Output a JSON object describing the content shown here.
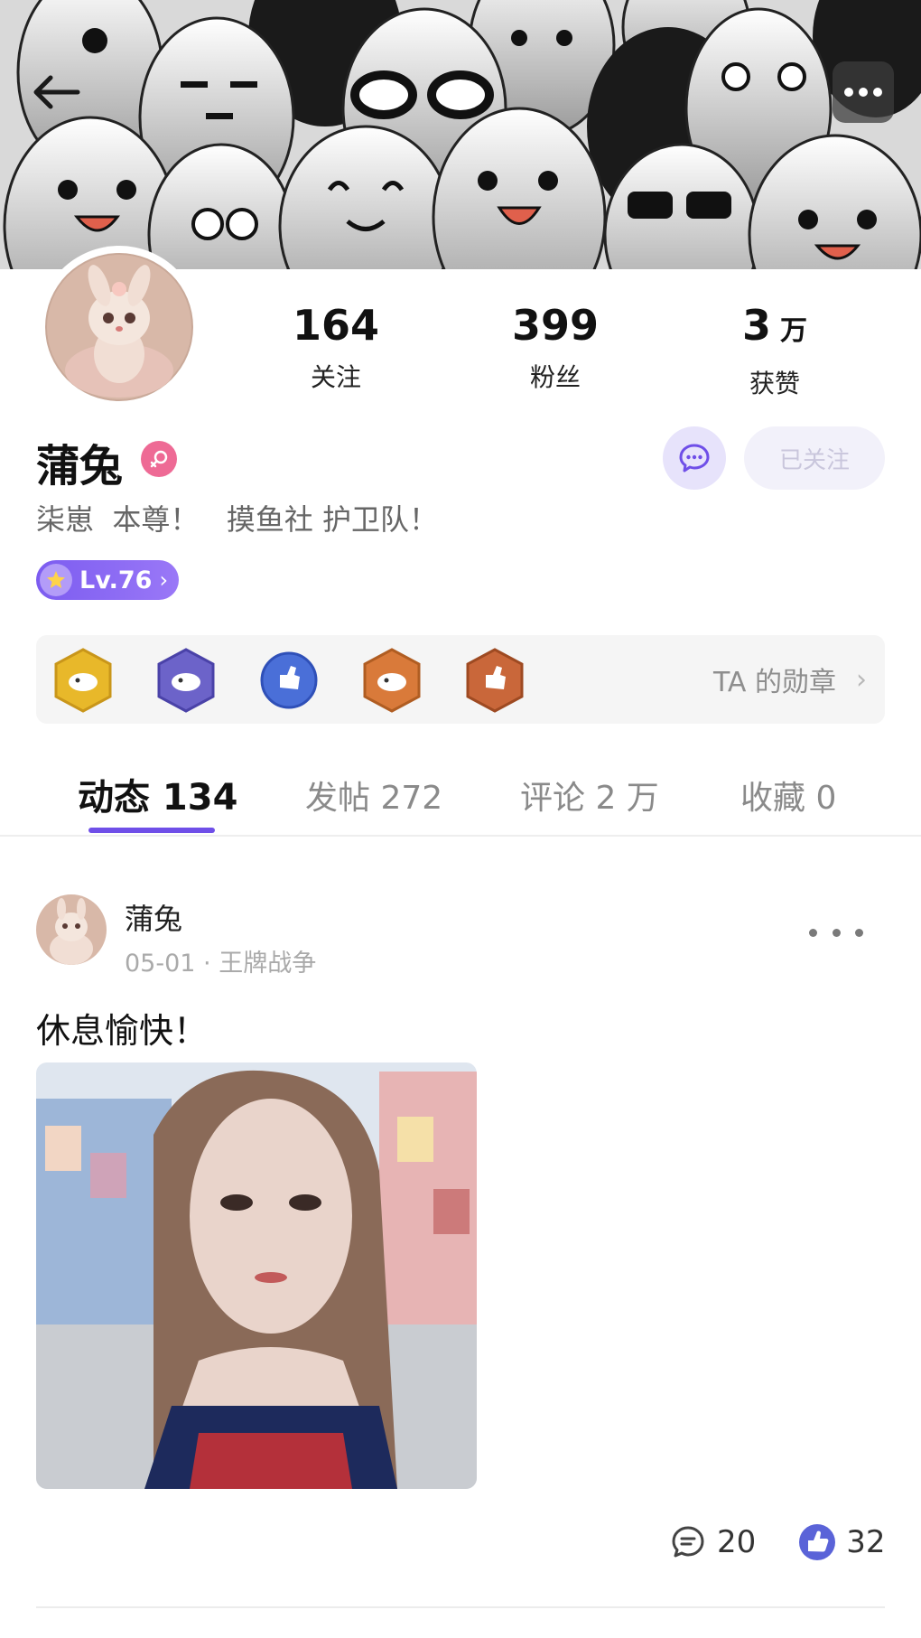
{
  "profile": {
    "name": "蒲兔",
    "bio": "柒崽  本尊！   摸鱼社 护卫队！",
    "level": "Lv.76",
    "stats": [
      {
        "value": "164",
        "unit": "",
        "label": "关注"
      },
      {
        "value": "399",
        "unit": "",
        "label": "粉丝"
      },
      {
        "value": "3",
        "unit": "万",
        "label": "获赞"
      }
    ],
    "follow_label": "已关注"
  },
  "medals": {
    "link_label": "TA 的勋章",
    "colors": [
      "#e8b82a",
      "#6c63c9",
      "#4a6fd8",
      "#d97a3a",
      "#c9673a"
    ]
  },
  "tabs": [
    {
      "label": "动态 134"
    },
    {
      "label": "发帖 272"
    },
    {
      "label": "评论 2 万"
    },
    {
      "label": "收藏 0"
    }
  ],
  "post": {
    "author": "蒲兔",
    "meta": "05-01 · 王牌战争",
    "text": "休息愉快！",
    "comments": "20",
    "likes": "32"
  },
  "colors": {
    "accent": "#6f4fe8",
    "gender": "#ee6a95"
  }
}
